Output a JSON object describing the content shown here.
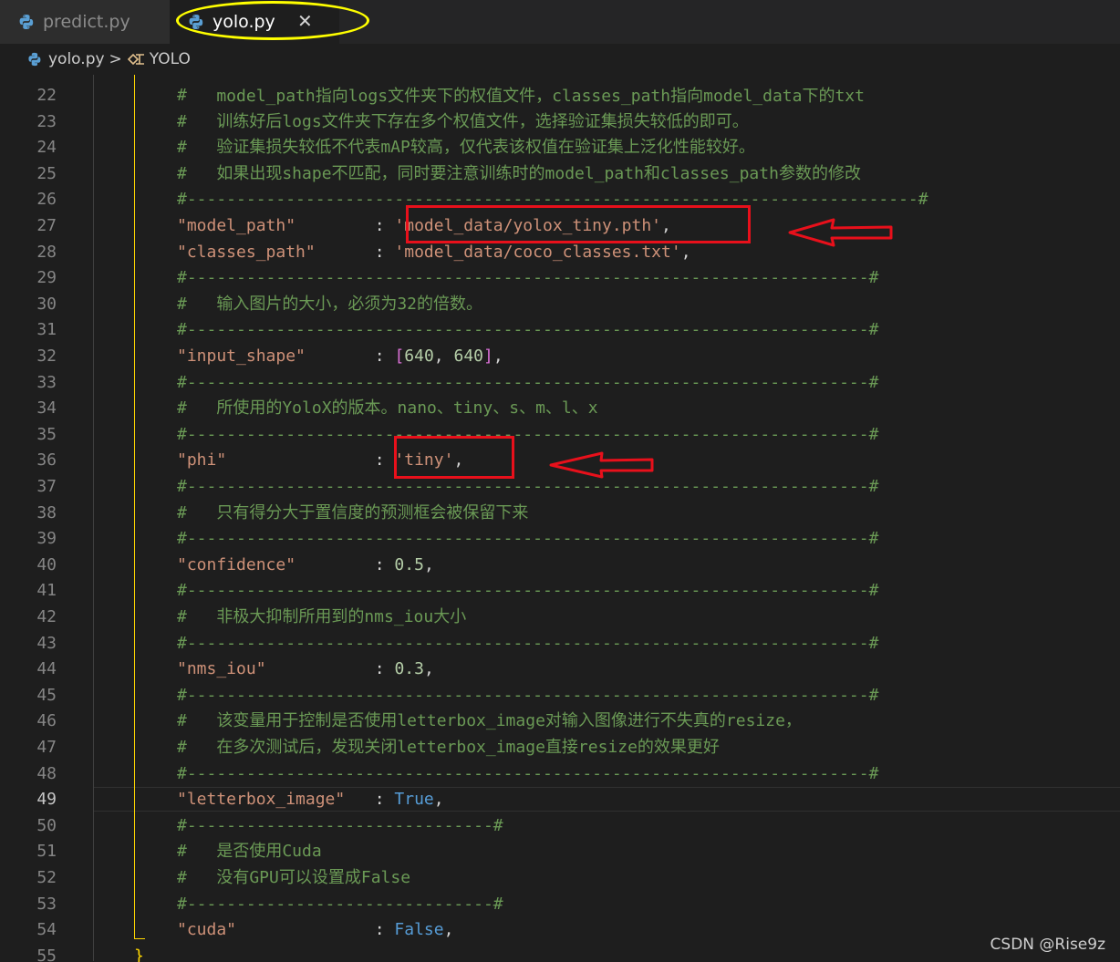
{
  "tabs": [
    {
      "label": "predict.py",
      "active": false
    },
    {
      "label": "yolo.py",
      "active": true,
      "close_glyph": "✕"
    }
  ],
  "breadcrumb": {
    "file": "yolo.py",
    "separator": ">",
    "symbol": "YOLO"
  },
  "icons": {
    "python_file": "python-icon",
    "symbol": "symbol-class-icon"
  },
  "colors": {
    "annotation_red": "#e8101b",
    "annotation_yellow": "#ffff00",
    "comment": "#6a9955",
    "string": "#ce9178"
  },
  "editor": {
    "current_line": 49,
    "partial_top_line": "    model_path指向logs文件夹下的权值文件，classes_path指向model_data下的txt",
    "lines": [
      {
        "n": 22,
        "tokens": [
          {
            "t": "#",
            "c": "com"
          }
        ]
      },
      {
        "n": 23,
        "tokens": [
          {
            "t": "#   训练好后logs文件夹下存在多个权值文件，选择验证集损失较低的即可。",
            "c": "com"
          }
        ]
      },
      {
        "n": 24,
        "tokens": [
          {
            "t": "#   验证集损失较低不代表mAP较高，仅代表该权值在验证集上泛化性能较好。",
            "c": "com"
          }
        ]
      },
      {
        "n": 25,
        "tokens": [
          {
            "t": "#   如果出现shape不匹配，同时要注意训练时的model_path和classes_path参数的修改",
            "c": "com"
          }
        ]
      },
      {
        "n": 26,
        "tokens": [
          {
            "t": "#--------------------------------------------------------------------------#",
            "c": "com"
          }
        ]
      },
      {
        "n": 27,
        "tokens": [
          {
            "t": "\"model_path\"",
            "c": "str"
          },
          {
            "t": "        : ",
            "c": "punc"
          },
          {
            "t": "'model_data/yolox_tiny.pth'",
            "c": "str"
          },
          {
            "t": ",",
            "c": "punc"
          }
        ]
      },
      {
        "n": 28,
        "tokens": [
          {
            "t": "\"classes_path\"",
            "c": "str"
          },
          {
            "t": "      : ",
            "c": "punc"
          },
          {
            "t": "'model_data/coco_classes.txt'",
            "c": "str"
          },
          {
            "t": ",",
            "c": "punc"
          }
        ]
      },
      {
        "n": 29,
        "tokens": [
          {
            "t": "#---------------------------------------------------------------------#",
            "c": "com"
          }
        ]
      },
      {
        "n": 30,
        "tokens": [
          {
            "t": "#   输入图片的大小，必须为32的倍数。",
            "c": "com"
          }
        ]
      },
      {
        "n": 31,
        "tokens": [
          {
            "t": "#---------------------------------------------------------------------#",
            "c": "com"
          }
        ]
      },
      {
        "n": 32,
        "tokens": [
          {
            "t": "\"input_shape\"",
            "c": "str"
          },
          {
            "t": "       : ",
            "c": "punc"
          },
          {
            "t": "[",
            "c": "brk"
          },
          {
            "t": "640",
            "c": "num"
          },
          {
            "t": ", ",
            "c": "punc"
          },
          {
            "t": "640",
            "c": "num"
          },
          {
            "t": "]",
            "c": "brk"
          },
          {
            "t": ",",
            "c": "punc"
          }
        ]
      },
      {
        "n": 33,
        "tokens": [
          {
            "t": "#---------------------------------------------------------------------#",
            "c": "com"
          }
        ]
      },
      {
        "n": 34,
        "tokens": [
          {
            "t": "#   所使用的YoloX的版本。nano、tiny、s、m、l、x",
            "c": "com"
          }
        ]
      },
      {
        "n": 35,
        "tokens": [
          {
            "t": "#---------------------------------------------------------------------#",
            "c": "com"
          }
        ]
      },
      {
        "n": 36,
        "tokens": [
          {
            "t": "\"phi\"",
            "c": "str"
          },
          {
            "t": "               : ",
            "c": "punc"
          },
          {
            "t": "'tiny'",
            "c": "str"
          },
          {
            "t": ",",
            "c": "punc"
          }
        ]
      },
      {
        "n": 37,
        "tokens": [
          {
            "t": "#---------------------------------------------------------------------#",
            "c": "com"
          }
        ]
      },
      {
        "n": 38,
        "tokens": [
          {
            "t": "#   只有得分大于置信度的预测框会被保留下来",
            "c": "com"
          }
        ]
      },
      {
        "n": 39,
        "tokens": [
          {
            "t": "#---------------------------------------------------------------------#",
            "c": "com"
          }
        ]
      },
      {
        "n": 40,
        "tokens": [
          {
            "t": "\"confidence\"",
            "c": "str"
          },
          {
            "t": "        : ",
            "c": "punc"
          },
          {
            "t": "0.5",
            "c": "num"
          },
          {
            "t": ",",
            "c": "punc"
          }
        ]
      },
      {
        "n": 41,
        "tokens": [
          {
            "t": "#---------------------------------------------------------------------#",
            "c": "com"
          }
        ]
      },
      {
        "n": 42,
        "tokens": [
          {
            "t": "#   非极大抑制所用到的nms_iou大小",
            "c": "com"
          }
        ]
      },
      {
        "n": 43,
        "tokens": [
          {
            "t": "#---------------------------------------------------------------------#",
            "c": "com"
          }
        ]
      },
      {
        "n": 44,
        "tokens": [
          {
            "t": "\"nms_iou\"",
            "c": "str"
          },
          {
            "t": "           : ",
            "c": "punc"
          },
          {
            "t": "0.3",
            "c": "num"
          },
          {
            "t": ",",
            "c": "punc"
          }
        ]
      },
      {
        "n": 45,
        "tokens": [
          {
            "t": "#---------------------------------------------------------------------#",
            "c": "com"
          }
        ]
      },
      {
        "n": 46,
        "tokens": [
          {
            "t": "#   该变量用于控制是否使用letterbox_image对输入图像进行不失真的resize，",
            "c": "com"
          }
        ]
      },
      {
        "n": 47,
        "tokens": [
          {
            "t": "#   在多次测试后，发现关闭letterbox_image直接resize的效果更好",
            "c": "com"
          }
        ]
      },
      {
        "n": 48,
        "tokens": [
          {
            "t": "#---------------------------------------------------------------------#",
            "c": "com"
          }
        ]
      },
      {
        "n": 49,
        "tokens": [
          {
            "t": "\"letterbox_image\"",
            "c": "str"
          },
          {
            "t": "   : ",
            "c": "punc"
          },
          {
            "t": "True",
            "c": "kw"
          },
          {
            "t": ",",
            "c": "punc"
          }
        ]
      },
      {
        "n": 50,
        "tokens": [
          {
            "t": "#-------------------------------#",
            "c": "com"
          }
        ]
      },
      {
        "n": 51,
        "tokens": [
          {
            "t": "#   是否使用Cuda",
            "c": "com"
          }
        ]
      },
      {
        "n": 52,
        "tokens": [
          {
            "t": "#   没有GPU可以设置成False",
            "c": "com"
          }
        ]
      },
      {
        "n": 53,
        "tokens": [
          {
            "t": "#-------------------------------#",
            "c": "com"
          }
        ]
      },
      {
        "n": 54,
        "tokens": [
          {
            "t": "\"cuda\"",
            "c": "str"
          },
          {
            "t": "              : ",
            "c": "punc"
          },
          {
            "t": "False",
            "c": "kw"
          },
          {
            "t": ",",
            "c": "punc"
          }
        ]
      },
      {
        "n": 55,
        "tokens": [
          {
            "t": "}",
            "c": "brace"
          }
        ],
        "indent": "brace"
      }
    ]
  },
  "watermark": "CSDN @Rise9z"
}
